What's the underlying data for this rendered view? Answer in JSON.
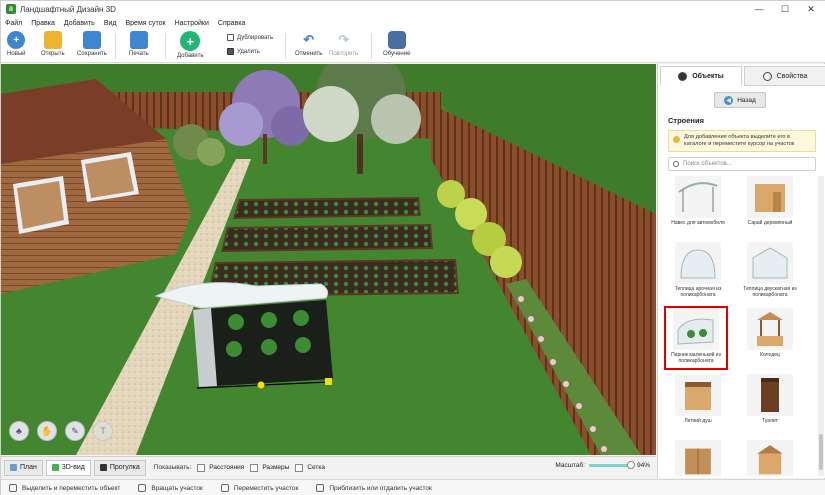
{
  "window": {
    "title": "Ландшафтный Дизайн 3D",
    "controls": {
      "minimize": "—",
      "maximize": "☐",
      "close": "✕"
    }
  },
  "menu": [
    "Файл",
    "Правка",
    "Добавить",
    "Вид",
    "Время суток",
    "Настройки",
    "Справка"
  ],
  "toolbar": {
    "new": "Новый",
    "open": "Открыть",
    "save": "Сохранить",
    "print": "Печать",
    "add": "Добавить",
    "duplicate": "Дублировать",
    "delete": "Удалить",
    "undo": "Отменить",
    "redo": "Повторить",
    "tutorial": "Обучение"
  },
  "viewbar": {
    "tabs": [
      "План",
      "3D-вид",
      "Прогулка"
    ],
    "active_tab": "3D-вид",
    "show_label": "Показывать:",
    "checkboxes": [
      "Расстояния",
      "Размеры",
      "Сетка"
    ],
    "scale_label": "Масштаб:",
    "scale_value": "94%"
  },
  "statusbar": [
    "Выделить и переместить объект",
    "Вращать участок",
    "Переместить участок",
    "Приблизить или отдалить участок"
  ],
  "panel": {
    "tabs": [
      "Объекты",
      "Свойства"
    ],
    "active_tab": "Объекты",
    "back": "Назад",
    "category": "Строения",
    "hint": "Для добавления объекта выделите его в каталоге и переместите курсор на участок",
    "search_placeholder": "Поиск объектов...",
    "items": [
      {
        "label": "Навес для автомобиля",
        "selected": false
      },
      {
        "label": "Сарай деревянный",
        "selected": false
      },
      {
        "label": "Теплица арочная из поликарбоната",
        "selected": false
      },
      {
        "label": "Теплица двускатная из поликарбоната",
        "selected": false
      },
      {
        "label": "Парник маленький из поликарбоната",
        "selected": true
      },
      {
        "label": "Колодец",
        "selected": false
      },
      {
        "label": "Летний душ",
        "selected": false
      },
      {
        "label": "Туалет",
        "selected": false
      },
      {
        "label": "",
        "selected": false
      },
      {
        "label": "",
        "selected": false
      }
    ]
  },
  "colors": {
    "accent_blue": "#3d86d4",
    "grass": "#3f7a2b",
    "selection_red": "#e00000"
  }
}
